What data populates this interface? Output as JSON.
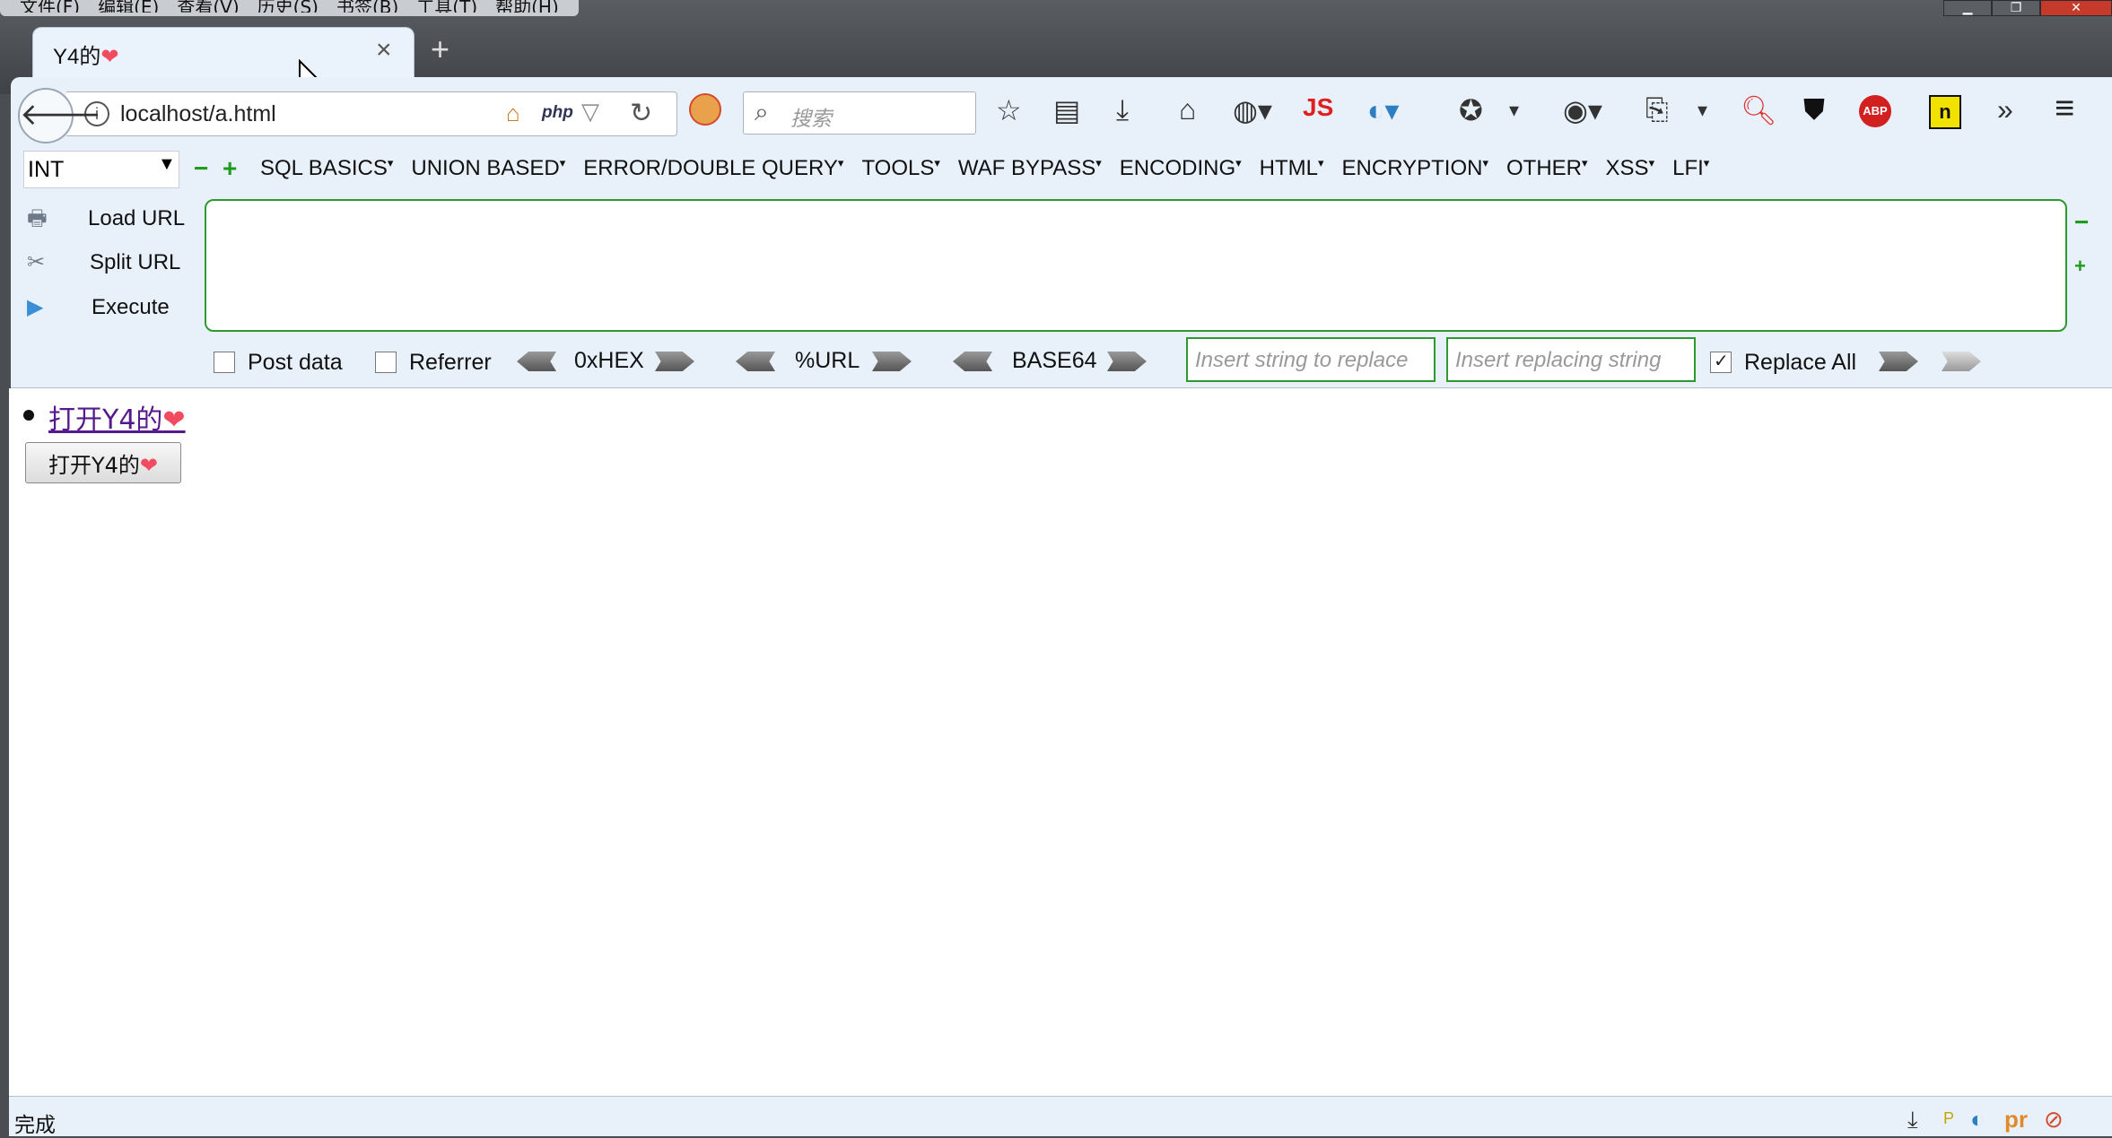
{
  "window": {
    "menu": [
      "文件(F)",
      "编辑(E)",
      "查看(V)",
      "历史(S)",
      "书签(B)",
      "工具(T)",
      "帮助(H)"
    ]
  },
  "tab": {
    "title": "Y4的",
    "heart": "❤",
    "close": "×",
    "new_tab": "+"
  },
  "navbar": {
    "url": "localhost/a.html",
    "php_badge": "php",
    "search_placeholder": "搜索",
    "js_label": "JS",
    "abp_label": "ABP",
    "overflow": "»"
  },
  "hackbar": {
    "type_select": "INT",
    "menus": [
      "SQL BASICS",
      "UNION BASED",
      "ERROR/DOUBLE QUERY",
      "TOOLS",
      "WAF BYPASS",
      "ENCODING",
      "HTML",
      "ENCRYPTION",
      "OTHER",
      "XSS",
      "LFI"
    ],
    "load_url": "Load URL",
    "split_url": "Split URL",
    "execute": "Execute",
    "url_value": "",
    "post_data": "Post data",
    "referrer": "Referrer",
    "hex": "0xHEX",
    "urlenc": "%URL",
    "base64": "BASE64",
    "replace_from_placeholder": "Insert string to replace",
    "replace_to_placeholder": "Insert replacing string",
    "replace_all": "Replace All",
    "post_checked": false,
    "referrer_checked": false,
    "replace_all_checked": true
  },
  "content": {
    "link_text": "打开Y4的",
    "button_text": "打开Y4的",
    "heart": "❤"
  },
  "status": {
    "text": "完成"
  },
  "colors": {
    "accent_green": "#2e9a2e",
    "link": "#551a8b",
    "heart": "#f04b5f"
  }
}
